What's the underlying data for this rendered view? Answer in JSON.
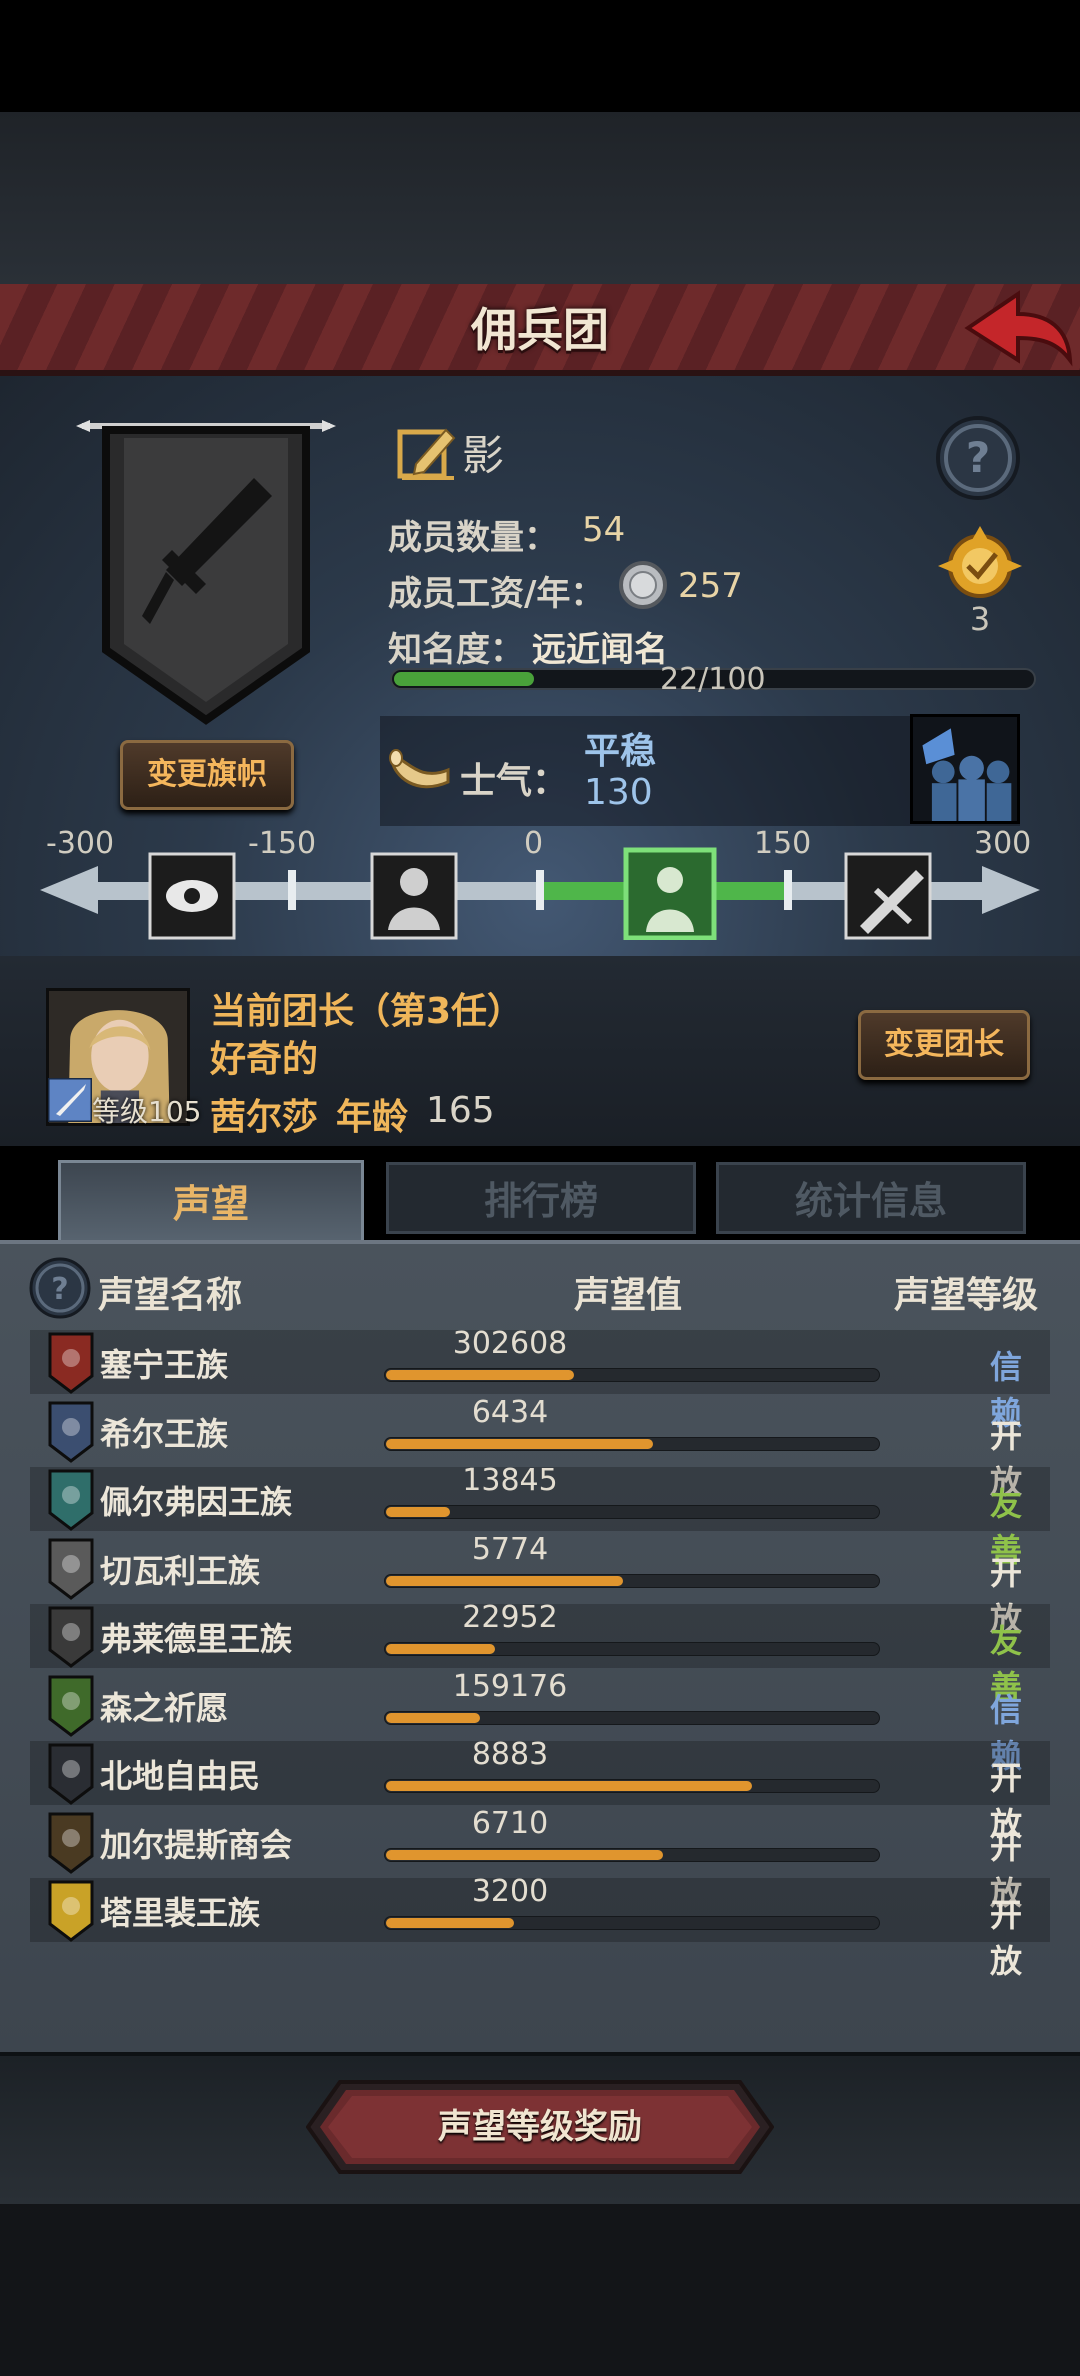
{
  "header": {
    "title": "佣兵团"
  },
  "guild": {
    "name": "影",
    "members_label": "成员数量：",
    "members": "54",
    "wage_label": "成员工资/年：",
    "wage": "257",
    "fame_label": "知名度：",
    "fame_value": "远近闻名",
    "fame_progress": "22/100",
    "fame_fraction": 0.22,
    "rank": "3",
    "change_banner_label": "变更旗帜"
  },
  "morale": {
    "label": "士气：",
    "state": "平稳",
    "value": "130",
    "scale_ticks": [
      "-300",
      "-150",
      "0",
      "150",
      "300"
    ]
  },
  "leader": {
    "title": "当前团长（第3任）",
    "trait": "好奇的",
    "level_label": "等级105",
    "name": "茜尔莎",
    "age_label": "年龄",
    "age": "165",
    "change_label": "变更团长"
  },
  "tabs": [
    {
      "label": "声望",
      "active": true
    },
    {
      "label": "排行榜",
      "active": false
    },
    {
      "label": "统计信息",
      "active": false
    }
  ],
  "reputation": {
    "headers": {
      "name": "声望名称",
      "value": "声望值",
      "level": "声望等级"
    },
    "rows": [
      {
        "name": "塞宁王族",
        "value": "302608",
        "fill": 0.38,
        "level": "信赖",
        "level_color": "#7fa6dc",
        "emblem_color": "#8a2a22"
      },
      {
        "name": "希尔王族",
        "value": "6434",
        "fill": 0.54,
        "level": "开放",
        "level_color": "#ece6d9",
        "emblem_color": "#3b4e70"
      },
      {
        "name": "佩尔弗因王族",
        "value": "13845",
        "fill": 0.13,
        "level": "友善",
        "level_color": "#8fc24a",
        "emblem_color": "#2f6e6a"
      },
      {
        "name": "切瓦利王族",
        "value": "5774",
        "fill": 0.48,
        "level": "开放",
        "level_color": "#ece6d9",
        "emblem_color": "#5a5a5a"
      },
      {
        "name": "弗莱德里王族",
        "value": "22952",
        "fill": 0.22,
        "level": "友善",
        "level_color": "#8fc24a",
        "emblem_color": "#3a3a3a"
      },
      {
        "name": "森之祈愿",
        "value": "159176",
        "fill": 0.19,
        "level": "信赖",
        "level_color": "#7fa6dc",
        "emblem_color": "#3f6a2a"
      },
      {
        "name": "北地自由民",
        "value": "8883",
        "fill": 0.74,
        "level": "开放",
        "level_color": "#ece6d9",
        "emblem_color": "#2a2d33"
      },
      {
        "name": "加尔提斯商会",
        "value": "6710",
        "fill": 0.56,
        "level": "开放",
        "level_color": "#ece6d9",
        "emblem_color": "#4a3a22"
      },
      {
        "name": "塔里裴王族",
        "value": "3200",
        "fill": 0.26,
        "level": "开放",
        "level_color": "#ece6d9",
        "emblem_color": "#c9a227"
      }
    ]
  },
  "footer": {
    "reward_label": "声望等级奖励"
  },
  "icons": {
    "back": "back-arrow-icon",
    "edit": "edit-pencil-icon",
    "coin": "silver-coin-icon",
    "horn": "horn-icon",
    "help": "question-icon",
    "rank": "rank-badge-icon"
  }
}
